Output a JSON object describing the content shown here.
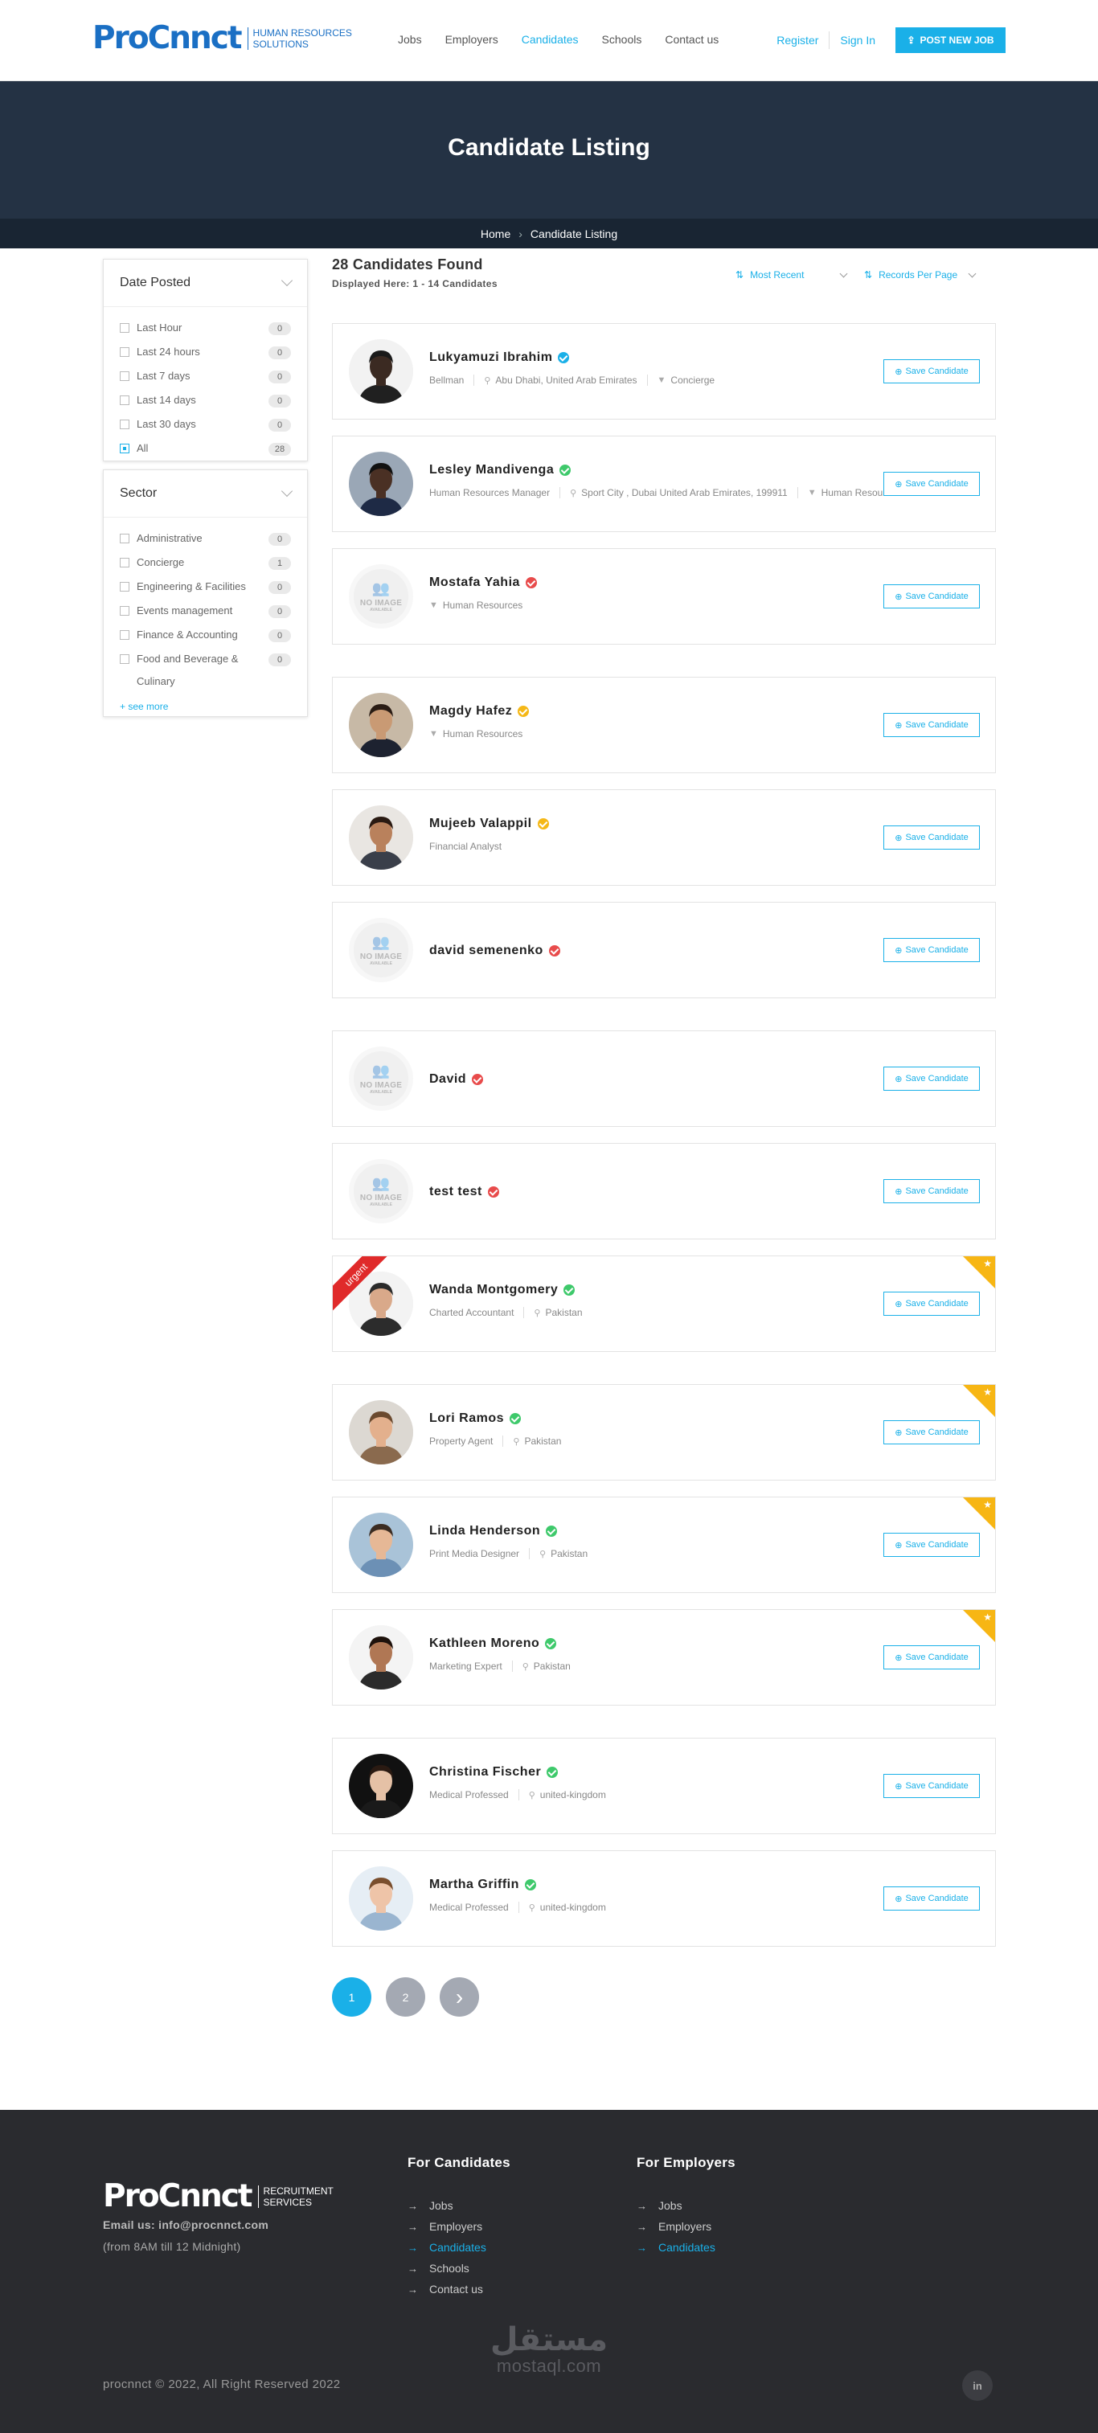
{
  "header": {
    "logo_text": "ProCnnct",
    "logo_sub": "HUMAN RESOURCES SOLUTIONS",
    "nav": [
      {
        "label": "Jobs",
        "active": false
      },
      {
        "label": "Employers",
        "active": false
      },
      {
        "label": "Candidates",
        "active": true
      },
      {
        "label": "Schools",
        "active": false
      },
      {
        "label": "Contact us",
        "active": false
      }
    ],
    "register": "Register",
    "signin": "Sign In",
    "post_job": "POST NEW JOB"
  },
  "hero": {
    "title": "Candidate Listing",
    "breadcrumb": [
      "Home",
      "Candidate Listing"
    ]
  },
  "filters": {
    "date_posted": {
      "title": "Date Posted",
      "items": [
        {
          "label": "Last Hour",
          "count": "0",
          "checked": false
        },
        {
          "label": "Last 24 hours",
          "count": "0",
          "checked": false
        },
        {
          "label": "Last 7 days",
          "count": "0",
          "checked": false
        },
        {
          "label": "Last 14 days",
          "count": "0",
          "checked": false
        },
        {
          "label": "Last 30 days",
          "count": "0",
          "checked": false
        },
        {
          "label": "All",
          "count": "28",
          "checked": true
        }
      ]
    },
    "sector": {
      "title": "Sector",
      "items": [
        {
          "label": "Administrative",
          "count": "0"
        },
        {
          "label": "Concierge",
          "count": "1"
        },
        {
          "label": "Engineering & Facilities",
          "count": "0"
        },
        {
          "label": "Events management",
          "count": "0"
        },
        {
          "label": "Finance & Accounting",
          "count": "0"
        },
        {
          "label": "Food and Beverage & Culinary",
          "count": "0"
        }
      ],
      "see_more": "+ see more"
    }
  },
  "results": {
    "found": "28 Candidates Found",
    "displayed": "Displayed Here: 1 - 14 Candidates",
    "sort_label": "Most Recent",
    "records_label": "Records Per Page"
  },
  "save_label": "Save Candidate",
  "urgent_label": "urgent",
  "candidates": [
    {
      "name": "Lukyamuzi Ibrahim",
      "badge": "#1ab0e8",
      "meta": [
        "Bellman",
        "Abu Dhabi, United Arab Emirates",
        "Concierge"
      ],
      "photo": "dark"
    },
    {
      "name": "Lesley Mandivenga",
      "badge": "#3ec96b",
      "meta": [
        "Human Resources Manager",
        "Sport City , Dubai United Arab Emirates, 199911",
        "Human Resources"
      ],
      "photo": "dark2"
    },
    {
      "name": "Mostafa Yahia",
      "badge": "#e84b4b",
      "meta": [
        "Human Resources"
      ],
      "photo": "none"
    },
    {
      "name": "Magdy Hafez",
      "badge": "#f5b817",
      "meta": [
        "Human Resources"
      ],
      "photo": "man1"
    },
    {
      "name": "Mujeeb Valappil",
      "badge": "#f5b817",
      "meta": [
        "Financial Analyst"
      ],
      "photo": "man2"
    },
    {
      "name": "david semenenko",
      "badge": "#e84b4b",
      "meta": [],
      "photo": "none"
    },
    {
      "name": "David",
      "badge": "#e84b4b",
      "meta": [],
      "photo": "none"
    },
    {
      "name": "test test",
      "badge": "#e84b4b",
      "meta": [],
      "photo": "none"
    },
    {
      "name": "Wanda Montgomery",
      "badge": "#3ec96b",
      "meta": [
        "Charted Accountant",
        "Pakistan"
      ],
      "photo": "man3",
      "urgent": true,
      "featured": true
    },
    {
      "name": "Lori Ramos",
      "badge": "#3ec96b",
      "meta": [
        "Property Agent",
        "Pakistan"
      ],
      "photo": "man4",
      "featured": true
    },
    {
      "name": "Linda Henderson",
      "badge": "#3ec96b",
      "meta": [
        "Print Media Designer",
        "Pakistan"
      ],
      "photo": "man5",
      "featured": true
    },
    {
      "name": "Kathleen Moreno",
      "badge": "#3ec96b",
      "meta": [
        "Marketing Expert",
        "Pakistan"
      ],
      "photo": "woman1",
      "featured": true
    },
    {
      "name": "Christina Fischer",
      "badge": "#3ec96b",
      "meta": [
        "Medical Professed",
        "united-kingdom"
      ],
      "photo": "woman2"
    },
    {
      "name": "Martha Griffin",
      "badge": "#3ec96b",
      "meta": [
        "Medical Professed",
        "united-kingdom"
      ],
      "photo": "woman3"
    }
  ],
  "no_image": {
    "line1": "NO IMAGE",
    "line2": "AVAILABLE"
  },
  "pagination": [
    "1",
    "2",
    "›"
  ],
  "footer": {
    "logo_text": "ProCnnct",
    "logo_sub": "RECRUITMENT SERVICES",
    "email": "Email us: info@procnnct.com",
    "hours": "(from 8AM till 12 Midnight)",
    "candidates_title": "For Candidates",
    "candidates_links": [
      {
        "label": "Jobs",
        "active": false
      },
      {
        "label": "Employers",
        "active": false
      },
      {
        "label": "Candidates",
        "active": true
      },
      {
        "label": "Schools",
        "active": false
      },
      {
        "label": "Contact us",
        "active": false
      }
    ],
    "employers_title": "For Employers",
    "employers_links": [
      {
        "label": "Jobs",
        "active": false
      },
      {
        "label": "Employers",
        "active": false
      },
      {
        "label": "Candidates",
        "active": true
      }
    ],
    "watermark_ar": "مستقل",
    "watermark_en": "mostaql.com",
    "copyright": "procnnct © 2022, All Right Reserved 2022",
    "linkedin": "in"
  }
}
